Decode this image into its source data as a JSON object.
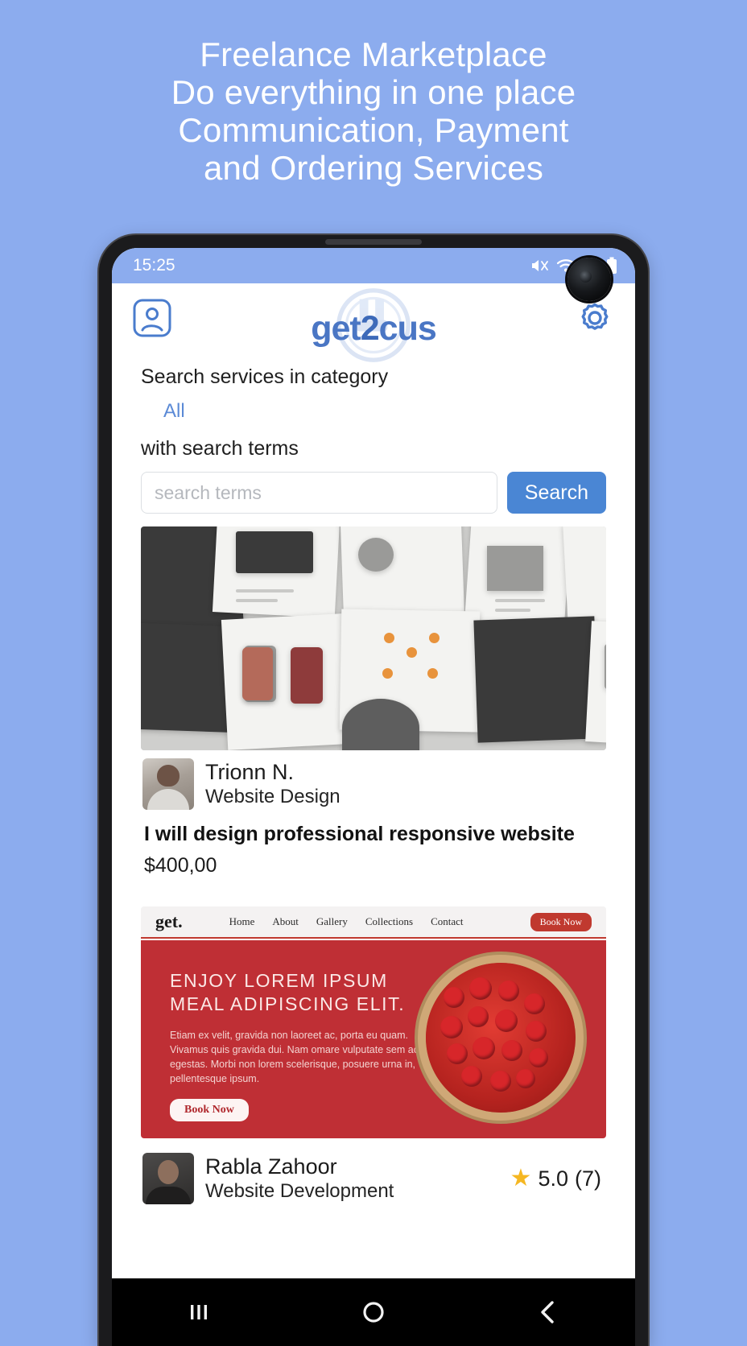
{
  "promo": {
    "lines": [
      "Freelance Marketplace",
      "Do everything in one place",
      "Communication, Payment",
      "and Ordering Services"
    ]
  },
  "colors": {
    "background": "#8cacee",
    "accent": "#4a86d4",
    "logo": "#4a76c4",
    "star": "#f5b722",
    "banner_red": "#bf2f35"
  },
  "status_bar": {
    "time": "15:25",
    "icons": [
      "mute-icon",
      "wifi-icon",
      "do-not-disturb-icon",
      "battery-icon"
    ]
  },
  "app_header": {
    "profile_icon": "profile-icon",
    "settings_icon": "gear-icon",
    "logo_left": "get",
    "logo_mid": "2",
    "logo_right": "cus",
    "logo_full": "get2cus"
  },
  "search": {
    "category_label": "Search services in category",
    "category_value": "All",
    "terms_label": "with search terms",
    "placeholder": "search terms",
    "input_value": "",
    "button_label": "Search"
  },
  "listings": [
    {
      "seller_name": "Trionn  N.",
      "seller_role": "Website Design",
      "title": "I will design professional responsive website",
      "price": "$400,00",
      "rating": "",
      "rating_count": ""
    },
    {
      "seller_name": "Rabla Zahoor",
      "seller_role": "Website Development",
      "title": "",
      "price": "",
      "rating": "5.0",
      "rating_count": "(7)"
    }
  ],
  "banner_mockup": {
    "logo": "get.",
    "nav_links": [
      "Home",
      "About",
      "Gallery",
      "Collections",
      "Contact"
    ],
    "nav_button": "Book Now",
    "headline_line1": "ENJOY LOREM IPSUM",
    "headline_line2": "MEAL ADIPISCING ELIT.",
    "body": "Etiam ex velit, gravida non laoreet ac, porta eu quam. Vivamus quis gravida dui. Nam omare vulputate sem ac egestas. Morbi non lorem scelerisque, posuere urna in, pellentesque ipsum.",
    "cta": "Book Now"
  },
  "android_nav": {
    "recents": "recents-icon",
    "home": "home-icon",
    "back": "back-icon"
  }
}
